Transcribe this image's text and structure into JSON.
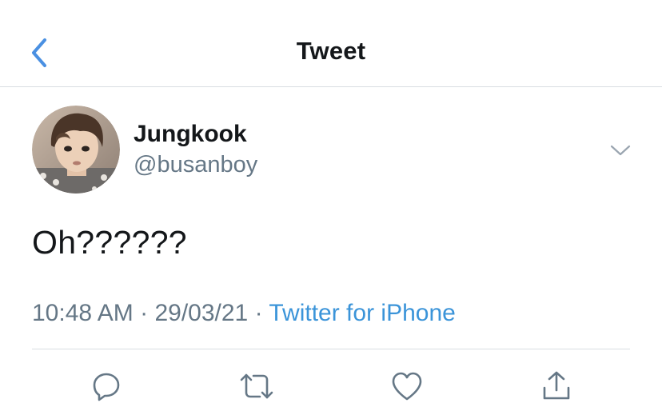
{
  "header": {
    "title": "Tweet",
    "back_icon": "chevron-left-icon"
  },
  "author": {
    "display_name": "Jungkook",
    "handle": "@busanboy"
  },
  "tweet": {
    "text": "Oh??????",
    "time": "10:48 AM",
    "separator": "·",
    "date": "29/03/21",
    "source": "Twitter for iPhone"
  },
  "actions": [
    "reply-icon",
    "retweet-icon",
    "like-icon",
    "share-icon"
  ],
  "colors": {
    "accent": "#4a90e2",
    "text": "#14171a",
    "secondary": "#657786",
    "divider": "#d8dde1",
    "icon": "#657786"
  }
}
